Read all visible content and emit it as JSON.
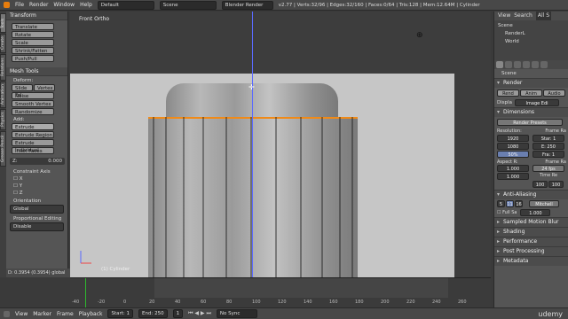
{
  "topbar": {
    "menus": [
      "File",
      "Render",
      "Window",
      "Help"
    ],
    "layout": "Default",
    "scene": "Scene",
    "engine": "Blender Render",
    "stats": "v2.77 | Verts:32/96 | Edges:32/160 | Faces:0/64 | Tris:128 | Mem:12.64M | Cylinder"
  },
  "vtabs": [
    "Tools",
    "Create",
    "Relations",
    "Animation",
    "Physics",
    "Grease Pencil"
  ],
  "toolshelf": {
    "transform_header": "Transform",
    "transform_buttons": [
      "Translate",
      "Rotate",
      "Scale",
      "Shrink/Fatten",
      "Push/Pull"
    ],
    "meshtools_header": "Mesh Tools",
    "deform_label": "Deform:",
    "slide_edge": "Slide Ed",
    "vertex": "Vertex",
    "noise": "Noise",
    "smooth_vertex": "Smooth Vertex",
    "randomize": "Randomize",
    "add_label": "Add:",
    "extrude": "Extrude",
    "extrude_region": "Extrude Region",
    "extrude_individual": "Extrude Individual",
    "inset_faces": "Inset Faces",
    "z_field": "Z:",
    "z_value": "0.000",
    "constraint_axis": "Constraint Axis",
    "axes": [
      "X",
      "Y",
      "Z"
    ],
    "orientation": "Orientation",
    "orientation_value": "Global",
    "prop_editing": "Proportional Editing",
    "prop_value": "Disable",
    "status": "D: 0.3954 (0.3954) global"
  },
  "viewport": {
    "view_label": "Front Ortho",
    "object_label": "(1) Cylinder"
  },
  "outliner": {
    "tabs": [
      "View",
      "Search",
      "All S"
    ],
    "items": [
      "Scene",
      "RenderL",
      "World"
    ]
  },
  "props": {
    "scene": "Scene",
    "render_header": "Render",
    "render_buttons": [
      "Rend",
      "Anim",
      "Audio"
    ],
    "display_label": "Displa",
    "display_value": "Image Edi",
    "dimensions_header": "Dimensions",
    "render_presets": "Render Presets",
    "resolution_label": "Resolution:",
    "frame_range_label": "Frame Ra",
    "res_x": "1920",
    "res_y": "1080",
    "res_pct": "50%",
    "start": "Star: 1",
    "end": "E: 250",
    "step": "Fra: 1",
    "aspect_label": "Aspect R:",
    "frame_rate_label": "Frame Ra",
    "aspect_x": "1.000",
    "aspect_y": "1.000",
    "fps": "24 fps",
    "time_re": "Time Re",
    "tr1": "100",
    "tr2": "100",
    "antialias_header": "Anti-Aliasing",
    "aa_samples": "11",
    "aa_val": "16",
    "aa_filter": "Mitchell",
    "full_sample": "Full Sa",
    "aa_size": "1.000",
    "sampled_motion": "Sampled Motion Blur",
    "shading": "Shading",
    "performance": "Performance",
    "post_processing": "Post Processing",
    "metadata": "Metadata"
  },
  "timeline": {
    "ticks": [
      "-40",
      "-20",
      "0",
      "20",
      "40",
      "60",
      "80",
      "100",
      "120",
      "140",
      "160",
      "180",
      "200",
      "220",
      "240",
      "260"
    ]
  },
  "bottombar": {
    "menus": [
      "View",
      "Marker",
      "Frame",
      "Playback"
    ],
    "start": "Start:",
    "start_val": "1",
    "end": "End:",
    "end_val": "250",
    "current": "1",
    "sync": "No Sync",
    "watermark": "udemy"
  }
}
